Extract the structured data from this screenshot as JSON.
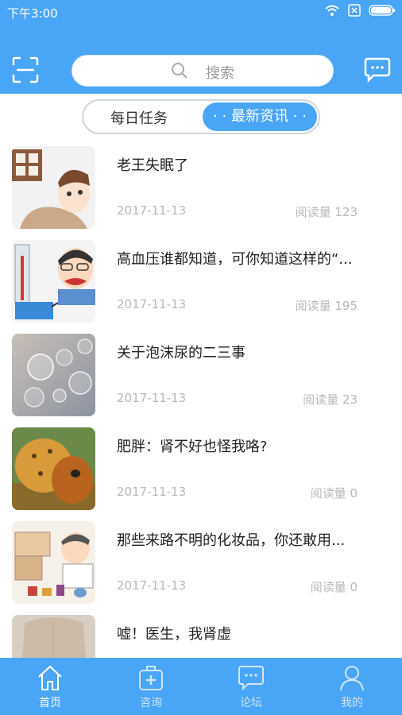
{
  "status": {
    "time": "下午3:00"
  },
  "search": {
    "placeholder": "搜索"
  },
  "segments": {
    "tab1": "每日任务",
    "tab2": "· · 最新资讯 · ·"
  },
  "articles": [
    {
      "title": "老王失眠了",
      "date": "2017-11-13",
      "reads": "阅读量 123"
    },
    {
      "title": "高血压谁都知道，可你知道这样的“...",
      "date": "2017-11-13",
      "reads": "阅读量 195"
    },
    {
      "title": "关于泡沫尿的二三事",
      "date": "2017-11-13",
      "reads": "阅读量 23"
    },
    {
      "title": "肥胖：肾不好也怪我咯?",
      "date": "2017-11-13",
      "reads": "阅读量 0"
    },
    {
      "title": "那些来路不明的化妆品，你还敢用...",
      "date": "2017-11-13",
      "reads": "阅读量 0"
    },
    {
      "title": "嘘！医生，我肾虚",
      "date": "",
      "reads": ""
    }
  ],
  "tabbar": {
    "home": "首页",
    "consult": "咨询",
    "forum": "论坛",
    "mine": "我的"
  },
  "colors": {
    "primary": "#49a5f5",
    "tab_inactive": "#cfe6fb",
    "meta_text": "#b8b8b8"
  }
}
